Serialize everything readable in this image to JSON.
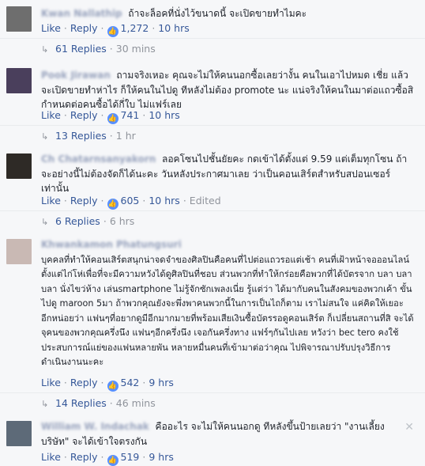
{
  "actions": {
    "like": "Like",
    "reply": "Reply",
    "sep": "·"
  },
  "comments": [
    {
      "name": "Kwan Nallathip",
      "text": "ถ้าจะล็อคที่นั่งไว้ขนาดนี้ จะเปิดขายทำไมคะ",
      "likes": "1,272",
      "time": "10 hrs",
      "edited": "",
      "replies_label": "61 Replies",
      "replies_time": "30 mins",
      "avatar_color": "#6e6e6e"
    },
    {
      "name": "Pook Jirawan",
      "text": "ถามจริงเหอะ คุณจะไม่ให้คนนอกซื้อเลยว่างั้น คนในเอาไปหมด เชี่ย แล้วจะเปิดขายทำห่าไร ก็ให้คนในไปดู ทีหลังไม่ต้อง promote นะ แน่จริงให้คนในมาต่อแถวซื้อสิ กำหนดต่อคนซื้อได้กี่ใบ ไม่แฟร์เลย",
      "likes": "741",
      "time": "10 hrs",
      "edited": "",
      "replies_label": "13 Replies",
      "replies_time": "1 hr",
      "avatar_color": "#4a3f5c"
    },
    {
      "name": "Ch Chatarnsanyakorn",
      "text": "ลอคโซนไปชั้นยัยคะ กดเข้าได้ตั้งแต่ 9.59 แต่เต็มทุกโซน ถ้าจะอย่างนี้ไม่ต้องจัดก็ได้นะคะ วันหลังประกาศมาเลย ว่าเป็นคอนเสิร์ตสำหรับสปอนเซอร์เท่านั้น",
      "likes": "605",
      "time": "10 hrs",
      "edited": "Edited",
      "replies_label": "6 Replies",
      "replies_time": "6 hrs",
      "avatar_color": "#2e2a26"
    },
    {
      "name": "Khwankamon Phatungsuri",
      "text": "บุคคลที่ทำให้คอนเสิร์ตสนุกน่าจดจำของศิลปินคือคนที่ไปต่อแถวรอแต่เช้า คนที่เฝ้าหน้าจอออนไลน์ตั้งแต่ไก่โห่เพื่อที่จะมีความหวังได้ดูศิลปินที่ชอบ ส่วนพวกที่ทำให้กร่อยคือพวกที่ได้บัตรจาก บลา บลา บลา นั่งไขว่ห้าง เล่นsmartphone ไม่รู้จักซักเพลงเนี่ย รู้แต่ว่า ได้มากับคนในสังคมของพวกเค้า ขั้นไปดู maroon 5มา ถ้าพวกคุณยังจะพึ่งพาคนพวกนี้ในการเป็นไถก็ตาม เราไม่สนใจ แค่คิดให้เยอะอีกหน่อยว่า แฟนๆที่อยากดูมีอีกมากมายที่พร้อมเสียเงินซื้อบัตรรอดูคอนเสิร์ต ก็เปลี่ยนสถานที่สิ จะได้จุคนของพวกคุณครึ่งนึง แฟนๆอีกครึ่งนึง เจอกันครึ่งทาง แฟร์ๆกันไปเลย หวังว่า bec tero คงใช้ประสบการณ์แย่ของแฟนหลายพัน หลายหมื่นคนที่เข้ามาต่อว่าคุณ ไปพิจารณาปรับปรุงวิธีการดำเนินงานนะคะ",
      "likes": "542",
      "time": "9 hrs",
      "edited": "",
      "replies_label": "14 Replies",
      "replies_time": "46 mins",
      "avatar_color": "#c9b9b4"
    },
    {
      "name": "William W. Indachak",
      "text": "คืออะไร จะไม่ให้คนนอกดู ทีหลังขึ้นป้ายเลยว่า \"งานเลี้ยงบริษัท\" จะได้เข้าใจตรงกัน",
      "likes": "519",
      "time": "9 hrs",
      "edited": "",
      "replies_label": "",
      "replies_time": "",
      "avatar_color": "#5d6a78"
    }
  ],
  "icons": {
    "like": "thumbs-up-icon",
    "reply_arrow": "reply-arrow-icon",
    "hide": "close-icon"
  }
}
